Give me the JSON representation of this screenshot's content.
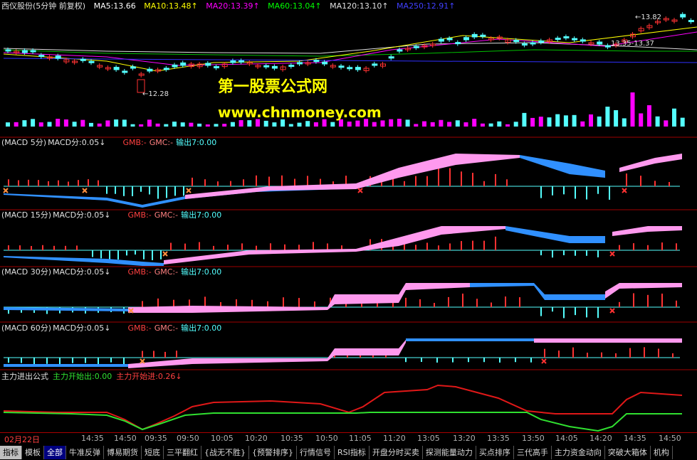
{
  "main_header": [
    {
      "text": "西仪股份(5分钟 前复权)",
      "color": "#e0e0e0"
    },
    {
      "text": "MA5:13.66",
      "color": "#ffffff"
    },
    {
      "text": "MA10:13.48↑",
      "color": "#ffff00"
    },
    {
      "text": "MA20:13.39↑",
      "color": "#ff00ff"
    },
    {
      "text": "MA60:13.04↑",
      "color": "#00ff00"
    },
    {
      "text": "MA120:13.10↑",
      "color": "#e0e0e0"
    },
    {
      "text": "MA250:12.91↑",
      "color": "#0000ff"
    }
  ],
  "price_labels": {
    "low": "←12.28",
    "high": "←13.82",
    "range": "13.35-13.37"
  },
  "watermark": {
    "line1": "第一股票公式网",
    "line2": "www.chnmoney.com"
  },
  "macd_panels": [
    {
      "title": "(MACD 5分)",
      "value": "MACD分:0.05↓",
      "gmb": "GMB:-",
      "gmc": "GMC:-",
      "out": "输出7:0.00"
    },
    {
      "title": "(MACD 15分)",
      "value": "MACD分:0.05↓",
      "gmb": "GMB:-",
      "gmc": "GMC:-",
      "out": "输出7:0.00"
    },
    {
      "title": "(MACD 30分)",
      "value": "MACD分:0.05↓",
      "gmb": "GMB:-",
      "gmc": "GMC:-",
      "out": "输出7:0.00"
    },
    {
      "title": "(MACD 60分)",
      "value": "MACD分:0.05↓",
      "gmb": "GMB:-",
      "gmc": "GMC:-",
      "out": "输出7:0.00"
    }
  ],
  "main_force": {
    "title": "主力进出公式",
    "out": "主力开始出:0.00",
    "in": "主力开始进:0.26↓"
  },
  "time_axis": [
    "02月22日",
    "14:35",
    "14:50",
    "09:35",
    "09:50",
    "10:05",
    "10:20",
    "10:35",
    "10:50",
    "11:05",
    "11:20",
    "13:05",
    "13:20",
    "13:35",
    "13:50",
    "14:05",
    "14:20",
    "14:35",
    "14:50"
  ],
  "tabs": [
    "指标",
    "模板",
    "全部",
    "牛准反弹",
    "博易期货",
    "短底",
    "三平翻红",
    "{战无不胜}",
    "{预警排序}",
    "行情信号",
    "RSI指标",
    "开盘分时买卖",
    "探测能量动力",
    "买点排序",
    "三代高手",
    "主力资金动向",
    "突破大箱体",
    "机构"
  ],
  "active_tab": "全部",
  "colors": {
    "up": "#ff3232",
    "down": "#54ffff",
    "pink": "#ff99ee",
    "blue": "#3090ff",
    "red_line": "#e01818",
    "green_line": "#30e030",
    "border": "#a00000"
  }
}
